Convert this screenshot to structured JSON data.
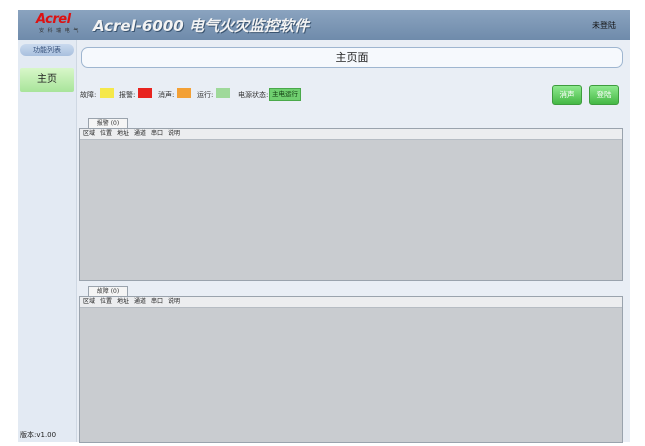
{
  "header": {
    "logo_text": "Acrel",
    "logo_tagline": "安 科 瑞 电 气",
    "app_title": "Acrel-6000 电气火灾监控软件",
    "login_status": "未登陆"
  },
  "sidebar": {
    "header_label": "功能列表",
    "items": [
      {
        "label": "主页"
      }
    ],
    "version": "版本:v1.00"
  },
  "main": {
    "page_title": "主页面",
    "status_legend": [
      {
        "label": "故障:",
        "color": "#f5e84a"
      },
      {
        "label": "报警:",
        "color": "#e8231f"
      },
      {
        "label": "消声:",
        "color": "#f3a035"
      },
      {
        "label": "运行:",
        "color": "#9fd99a"
      }
    ],
    "power_status_label": "电源状态:",
    "power_status_value": "主电运行",
    "buttons": {
      "silence": "消声",
      "login": "登陆"
    },
    "alarm_panel": {
      "tab_label": "报警 (0)",
      "columns": [
        "区域",
        "位置",
        "地址",
        "通道",
        "串口",
        "说明"
      ]
    },
    "fault_panel": {
      "tab_label": "故障 (0)",
      "columns": [
        "区域",
        "位置",
        "地址",
        "通道",
        "串口",
        "说明"
      ]
    }
  }
}
